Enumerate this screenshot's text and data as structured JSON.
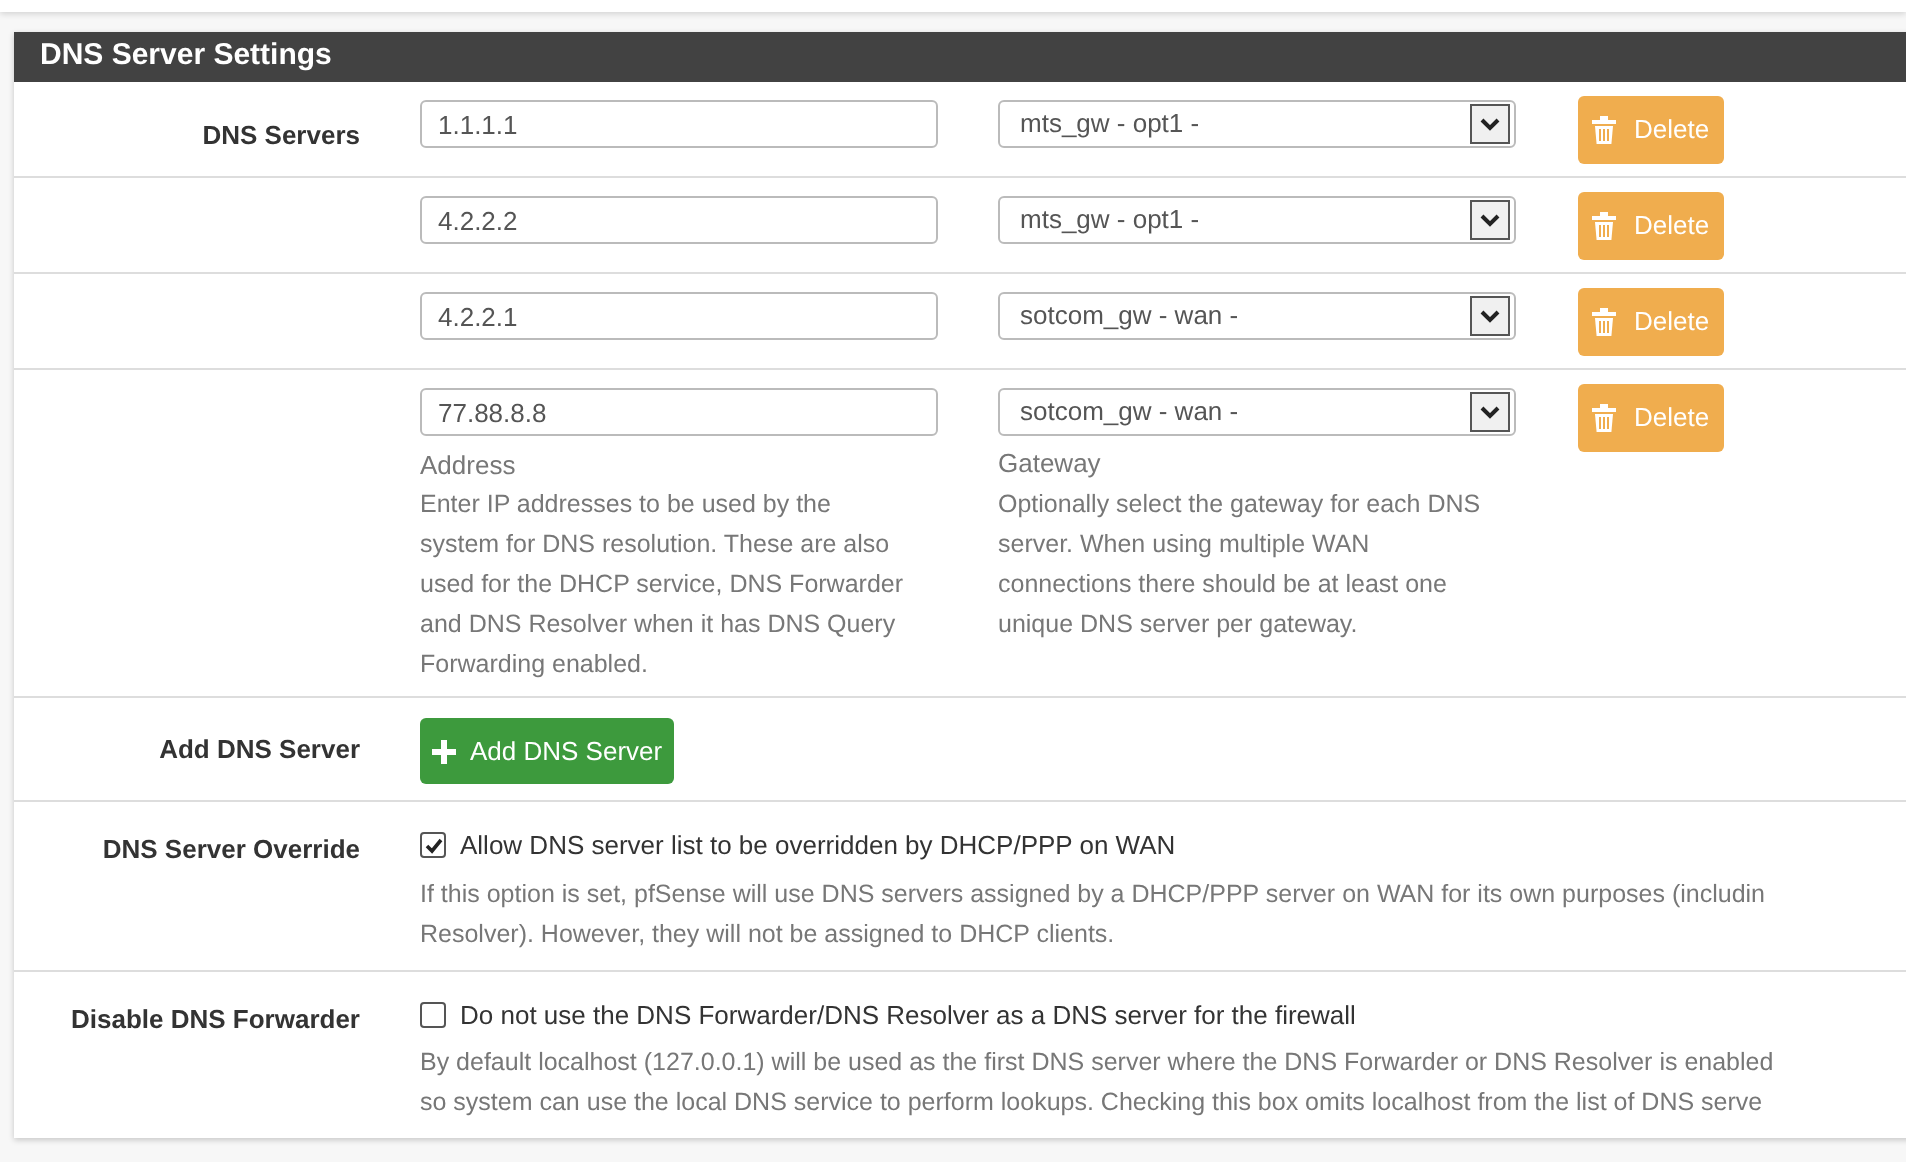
{
  "panel": {
    "title": "DNS Server Settings"
  },
  "dns_servers": {
    "label": "DNS Servers",
    "rows": [
      {
        "address": "1.1.1.1",
        "gateway": "mts_gw - opt1 -",
        "delete": "Delete"
      },
      {
        "address": "4.2.2.2",
        "gateway": "mts_gw - opt1 -",
        "delete": "Delete"
      },
      {
        "address": "4.2.2.1",
        "gateway": "sotcom_gw - wan -",
        "delete": "Delete"
      },
      {
        "address": "77.88.8.8",
        "gateway": "sotcom_gw - wan -",
        "delete": "Delete"
      }
    ],
    "address_caption": "Address",
    "address_help": "Enter IP addresses to be used by the system for DNS resolution. These are also used for the DHCP service, DNS Forwarder and DNS Resolver when it has DNS Query Forwarding enabled.",
    "gateway_caption": "Gateway",
    "gateway_help": "Optionally select the gateway for each DNS server. When using multiple WAN connections there should be at least one unique DNS server per gateway."
  },
  "add_dns_server": {
    "label": "Add DNS Server",
    "button": "Add DNS Server"
  },
  "options": [
    {
      "label": "DNS Server Override",
      "checkbox": "Allow DNS server list to be overridden by DHCP/PPP on WAN",
      "checked": true,
      "help": [
        "If this option is set, pfSense will use DNS servers assigned by a DHCP/PPP server on WAN for its own purposes (includin",
        "Resolver). However, they will not be assigned to DHCP clients."
      ]
    },
    {
      "label": "Disable DNS Forwarder",
      "checkbox": "Do not use the DNS Forwarder/DNS Resolver as a DNS server for the firewall",
      "checked": false,
      "help": [
        "By default localhost (127.0.0.1) will be used as the first DNS server where the DNS Forwarder or DNS Resolver is enabled",
        "so system can use the local DNS service to perform lookups. Checking this box omits localhost from the list of DNS serve"
      ]
    }
  ]
}
